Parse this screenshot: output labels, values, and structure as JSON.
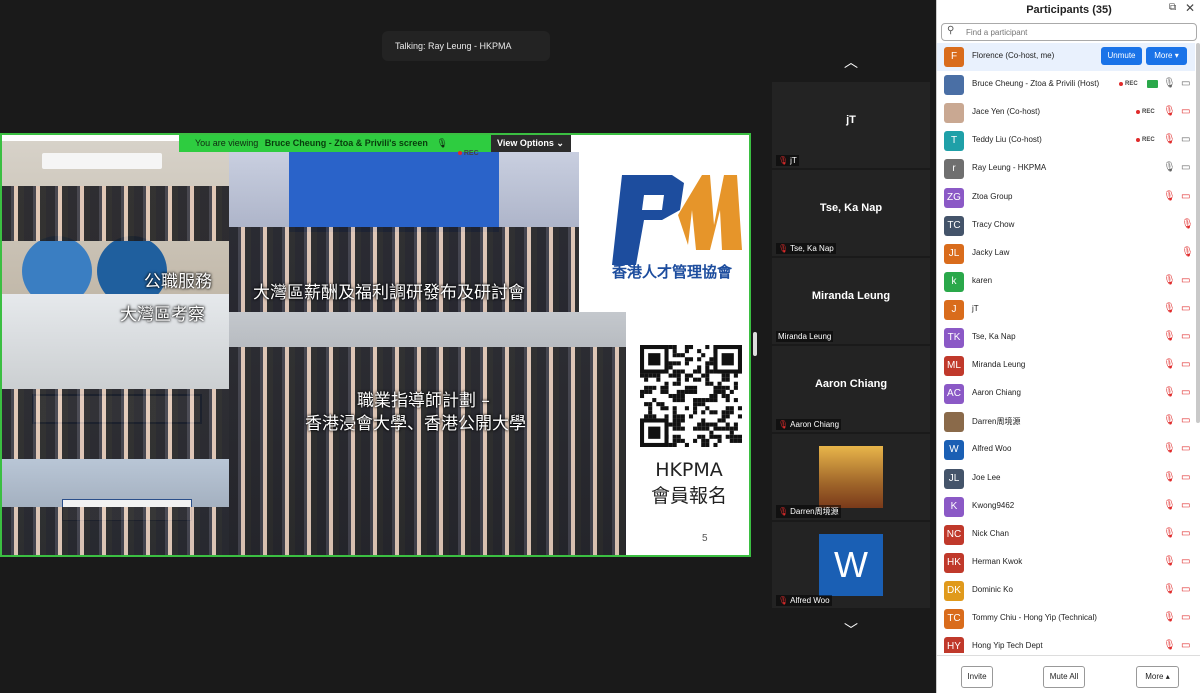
{
  "talking": "Talking: Ray Leung - HKPMA",
  "share_bar": {
    "prefix": "You are viewing",
    "who": "Bruce Cheung - Ztoa & Privili's screen",
    "rec": "REC",
    "view_options": "View Options"
  },
  "slide": {
    "captions": {
      "civil": "公職服務",
      "gba": "大灣區考察",
      "survey": "大灣區薪酬及福利調研發布及研討會",
      "mentor_line1": "職業指導師計劃 –",
      "mentor_line2": "香港浸會大學、香港公開大學"
    },
    "logo_text": "香港人才管理協會",
    "hkpma_line1": "HKPMA",
    "hkpma_line2": "會員報名",
    "page": "5"
  },
  "gallery": [
    {
      "name": "jT",
      "label": "jT"
    },
    {
      "name": "Tse, Ka Nap",
      "label": "Tse, Ka Nap"
    },
    {
      "name": "Miranda Leung",
      "label": "Miranda Leung"
    },
    {
      "name": "Aaron Chiang",
      "label": "Aaron Chiang"
    },
    {
      "name": "",
      "label": "Darren周境源"
    },
    {
      "name": "",
      "label": "Alfred Woo"
    }
  ],
  "panel": {
    "title": "Participants (35)",
    "search_placeholder": "Find a participant",
    "unmute": "Unmute",
    "more": "More ▾",
    "rec": "REC",
    "participants": [
      {
        "initials": "F",
        "name": "Florence (Co-host, me)",
        "color": "#d96c1c"
      },
      {
        "initials": "",
        "name": "Bruce Cheung - Ztoa & Privili (Host)",
        "color": "#4a6fa5"
      },
      {
        "initials": "",
        "name": "Jace Yen (Co-host)",
        "color": "#c9a892"
      },
      {
        "initials": "T",
        "name": "Teddy Liu (Co-host)",
        "color": "#1fa0a8"
      },
      {
        "initials": "r",
        "name": "Ray Leung - HKPMA",
        "color": "#6f6f6f"
      },
      {
        "initials": "ZG",
        "name": "Ztoa Group",
        "color": "#8b59c6"
      },
      {
        "initials": "TC",
        "name": "Tracy Chow",
        "color": "#44546a"
      },
      {
        "initials": "JL",
        "name": "Jacky Law",
        "color": "#d96c1c"
      },
      {
        "initials": "k",
        "name": "karen",
        "color": "#2aa84a"
      },
      {
        "initials": "J",
        "name": "jT",
        "color": "#d96c1c"
      },
      {
        "initials": "TK",
        "name": "Tse, Ka Nap",
        "color": "#8b59c6"
      },
      {
        "initials": "ML",
        "name": "Miranda Leung",
        "color": "#c0392b"
      },
      {
        "initials": "AC",
        "name": "Aaron Chiang",
        "color": "#8b59c6"
      },
      {
        "initials": "",
        "name": "Darren周境源",
        "color": "#8a6a4a"
      },
      {
        "initials": "W",
        "name": "Alfred Woo",
        "color": "#1a5fb4"
      },
      {
        "initials": "JL",
        "name": "Joe Lee",
        "color": "#44546a"
      },
      {
        "initials": "K",
        "name": "Kwong9462",
        "color": "#8b59c6"
      },
      {
        "initials": "NC",
        "name": "Nick Chan",
        "color": "#c0392b"
      },
      {
        "initials": "HK",
        "name": "Herman Kwok",
        "color": "#c0392b"
      },
      {
        "initials": "DK",
        "name": "Dominic Ko",
        "color": "#e09a1c"
      },
      {
        "initials": "TC",
        "name": "Tommy Chiu - Hong Yip (Technical)",
        "color": "#d96c1c"
      },
      {
        "initials": "HY",
        "name": "Hong Yip Tech Dept",
        "color": "#c0392b"
      }
    ],
    "footer": {
      "invite": "Invite",
      "mute_all": "Mute All",
      "more": "More ▴"
    }
  }
}
